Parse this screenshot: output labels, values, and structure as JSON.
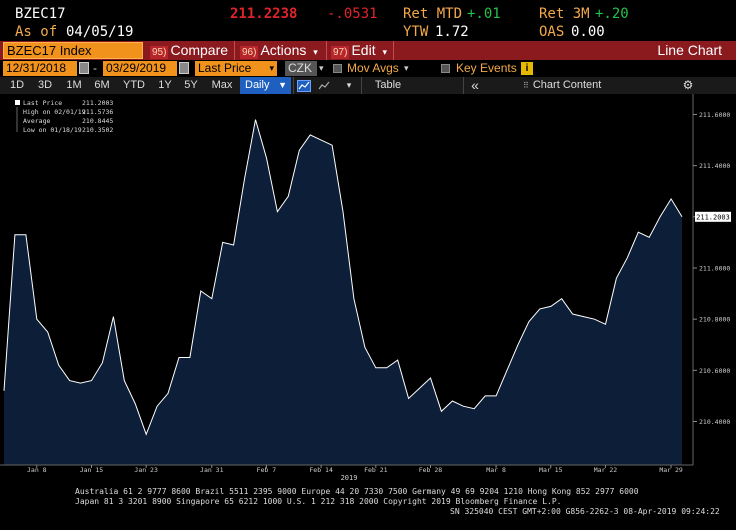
{
  "header": {
    "ticker": "BZEC17",
    "last_price": "211.2238",
    "change": "-.0531",
    "ret_mtd_label": "Ret MTD",
    "ret_mtd_value": "+.01",
    "ret_3m_label": "Ret 3M",
    "ret_3m_value": "+.20",
    "as_of_label": "As of",
    "as_of_date": "04/05/19",
    "ytw_label": "YTW",
    "ytw_value": "1.72",
    "oas_label": "OAS",
    "oas_value": "0.00"
  },
  "toolbar": {
    "ticker_field": "BZEC17 Index",
    "compare_num": "95)",
    "compare_label": "Compare",
    "actions_num": "96)",
    "actions_label": "Actions",
    "actions_caret": "▾",
    "edit_num": "97)",
    "edit_label": "Edit",
    "edit_caret": "▾",
    "view_title": "Line Chart"
  },
  "datebar": {
    "start_date": "12/31/2018",
    "dash": "-",
    "end_date": "03/29/2019",
    "field": "Last Price",
    "field_caret": "▾",
    "currency": "CZK",
    "currency_caret": "▾",
    "mov_avgs_label": "Mov Avgs",
    "mov_avgs_caret": "▾",
    "key_events_label": "Key Events",
    "info_glyph": "i"
  },
  "periodbar": {
    "periods": [
      "1D",
      "3D",
      "1M",
      "6M",
      "YTD",
      "1Y",
      "5Y",
      "Max"
    ],
    "frequency": "Daily",
    "frequency_caret": "▼",
    "table_label": "Table",
    "collapse_glyph": "«",
    "chart_content_label": "Chart Content",
    "settings_glyph": "⚙"
  },
  "legend": {
    "last_price_label": "Last Price",
    "last_price_value": "211.2003",
    "high_label": "High on 02/01/19",
    "high_value": "211.5736",
    "average_label": "Average",
    "average_value": "210.8445",
    "low_label": "Low on 01/18/19",
    "low_value": "210.3502"
  },
  "chart_data": {
    "type": "area",
    "x_ticks": [
      "Jan 8",
      "Jan 15",
      "Jan 23",
      "Jan 31",
      "Feb 7",
      "Feb 14",
      "Feb 21",
      "Feb 28",
      "Mar 8",
      "Mar 15",
      "Mar 22",
      "Mar 29"
    ],
    "x_year_label": "2019",
    "y_ticks": [
      "211.6000",
      "211.4000",
      "211.2000",
      "211.0000",
      "210.8000",
      "210.6000",
      "210.4000"
    ],
    "ylim": [
      210.23,
      211.68
    ],
    "last_value_label": "211.2003",
    "series": [
      {
        "values": [
          210.52,
          211.13,
          211.13,
          210.8,
          210.75,
          210.62,
          210.56,
          210.55,
          210.56,
          210.63,
          210.81,
          210.56,
          210.47,
          210.35,
          210.46,
          210.51,
          210.65,
          210.65,
          210.91,
          210.88,
          211.1,
          211.09,
          211.35,
          211.58,
          211.43,
          211.22,
          211.28,
          211.46,
          211.52,
          211.5,
          211.48,
          211.22,
          210.88,
          210.69,
          210.61,
          210.61,
          210.64,
          210.49,
          210.53,
          210.57,
          210.44,
          210.48,
          210.46,
          210.45,
          210.5,
          210.5,
          210.6,
          210.7,
          210.79,
          210.84,
          210.85,
          210.88,
          210.82,
          210.81,
          210.8,
          210.78,
          210.96,
          211.04,
          211.14,
          211.12,
          211.2,
          211.27,
          211.2
        ]
      }
    ]
  },
  "footer": {
    "line1": "Australia 61 2 9777 8600 Brazil 5511 2395 9000 Europe 44 20 7330 7500 Germany 49 69 9204 1210 Hong Kong 852 2977 6000",
    "line2": "Japan 81 3 3201 8900        Singapore 65 6212 1000        U.S. 1 212 318 2000            Copyright 2019 Bloomberg Finance L.P.",
    "line3": "SN 325040 CEST GMT+2:00 G856-2262-3 08-Apr-2019 09:24:22"
  },
  "colors": {
    "amber": "#f3a94b",
    "toolbar_red": "#8b1a1f",
    "area_fill": "#0d1f38",
    "line": "#ffffff"
  }
}
